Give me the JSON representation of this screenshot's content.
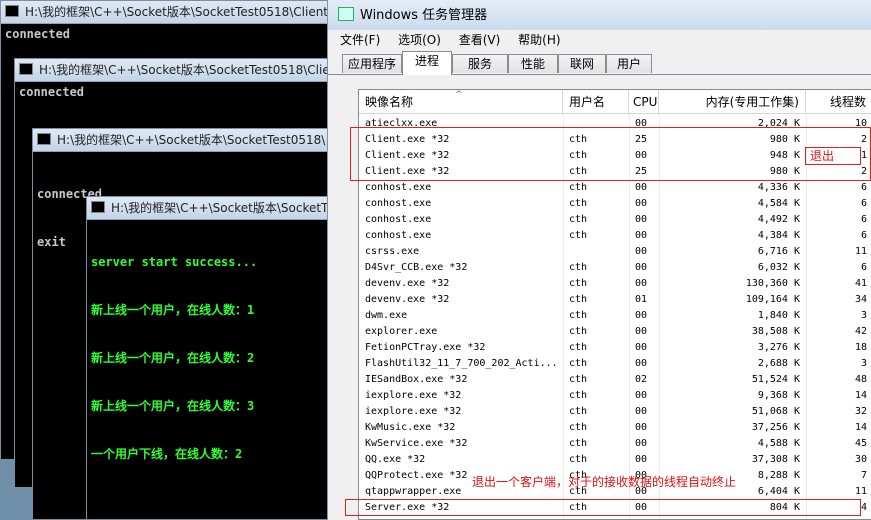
{
  "consoles": [
    {
      "title": "H:\\我的框架\\C++\\Socket版本\\SocketTest0518\\Client\\",
      "lines": [
        "connected"
      ]
    },
    {
      "title": "H:\\我的框架\\C++\\Socket版本\\SocketTest0518\\Clie",
      "lines": [
        "connected"
      ]
    },
    {
      "title": "H:\\我的框架\\C++\\Socket版本\\SocketTest0518\\",
      "lines": [
        "connected",
        "exit"
      ]
    },
    {
      "title": "H:\\我的框架\\C++\\Socket版本\\SocketTe",
      "lines": [
        "server start success...",
        "新上线一个用户，在线人数：1",
        "新上线一个用户，在线人数：2",
        "新上线一个用户，在线人数：3",
        "一个用户下线，在线人数：2"
      ]
    }
  ],
  "task_manager": {
    "title": "Windows 任务管理器",
    "menu": [
      "文件(F)",
      "选项(O)",
      "查看(V)",
      "帮助(H)"
    ],
    "tabs": [
      "应用程序",
      "进程",
      "服务",
      "性能",
      "联网",
      "用户"
    ],
    "active_tab": "进程",
    "columns": [
      "映像名称",
      "用户名",
      "CPU",
      "内存(专用工作集)",
      "线程数"
    ],
    "rows": [
      {
        "name": "atieclxx.exe",
        "user": "",
        "cpu": "00",
        "mem": "2,024 K",
        "threads": "10"
      },
      {
        "name": "Client.exe *32",
        "user": "cth",
        "cpu": "25",
        "mem": "980 K",
        "threads": "2"
      },
      {
        "name": "Client.exe *32",
        "user": "cth",
        "cpu": "00",
        "mem": "948 K",
        "threads": "1"
      },
      {
        "name": "Client.exe *32",
        "user": "cth",
        "cpu": "25",
        "mem": "980 K",
        "threads": "2"
      },
      {
        "name": "conhost.exe",
        "user": "cth",
        "cpu": "00",
        "mem": "4,336 K",
        "threads": "6"
      },
      {
        "name": "conhost.exe",
        "user": "cth",
        "cpu": "00",
        "mem": "4,584 K",
        "threads": "6"
      },
      {
        "name": "conhost.exe",
        "user": "cth",
        "cpu": "00",
        "mem": "4,492 K",
        "threads": "6"
      },
      {
        "name": "conhost.exe",
        "user": "cth",
        "cpu": "00",
        "mem": "4,384 K",
        "threads": "6"
      },
      {
        "name": "csrss.exe",
        "user": "",
        "cpu": "00",
        "mem": "6,716 K",
        "threads": "11"
      },
      {
        "name": "D4Svr_CCB.exe *32",
        "user": "cth",
        "cpu": "00",
        "mem": "6,032 K",
        "threads": "6"
      },
      {
        "name": "devenv.exe *32",
        "user": "cth",
        "cpu": "00",
        "mem": "130,360 K",
        "threads": "41"
      },
      {
        "name": "devenv.exe *32",
        "user": "cth",
        "cpu": "01",
        "mem": "109,164 K",
        "threads": "34"
      },
      {
        "name": "dwm.exe",
        "user": "cth",
        "cpu": "00",
        "mem": "1,840 K",
        "threads": "3"
      },
      {
        "name": "explorer.exe",
        "user": "cth",
        "cpu": "00",
        "mem": "38,508 K",
        "threads": "42"
      },
      {
        "name": "FetionPCTray.exe *32",
        "user": "cth",
        "cpu": "00",
        "mem": "3,276 K",
        "threads": "18"
      },
      {
        "name": "FlashUtil32_11_7_700_202_Acti...",
        "user": "cth",
        "cpu": "00",
        "mem": "2,688 K",
        "threads": "3"
      },
      {
        "name": "IESandBox.exe *32",
        "user": "cth",
        "cpu": "02",
        "mem": "51,524 K",
        "threads": "48"
      },
      {
        "name": "iexplore.exe *32",
        "user": "cth",
        "cpu": "00",
        "mem": "9,368 K",
        "threads": "14"
      },
      {
        "name": "iexplore.exe *32",
        "user": "cth",
        "cpu": "00",
        "mem": "51,068 K",
        "threads": "32"
      },
      {
        "name": "KwMusic.exe *32",
        "user": "cth",
        "cpu": "00",
        "mem": "37,256 K",
        "threads": "14"
      },
      {
        "name": "KwService.exe *32",
        "user": "cth",
        "cpu": "00",
        "mem": "4,588 K",
        "threads": "45"
      },
      {
        "name": "QQ.exe *32",
        "user": "cth",
        "cpu": "00",
        "mem": "37,308 K",
        "threads": "30"
      },
      {
        "name": "QQProtect.exe *32",
        "user": "cth",
        "cpu": "00",
        "mem": "8,288 K",
        "threads": "7"
      },
      {
        "name": "qtappwrapper.exe",
        "user": "cth",
        "cpu": "00",
        "mem": "6,404 K",
        "threads": "11"
      },
      {
        "name": "Server.exe *32",
        "user": "cth",
        "cpu": "00",
        "mem": "804 K",
        "threads": "4"
      }
    ]
  },
  "annotations": {
    "exit_label": "退出",
    "server_note": "退出一个客户端，对于的接收数据的线程自动终止"
  }
}
